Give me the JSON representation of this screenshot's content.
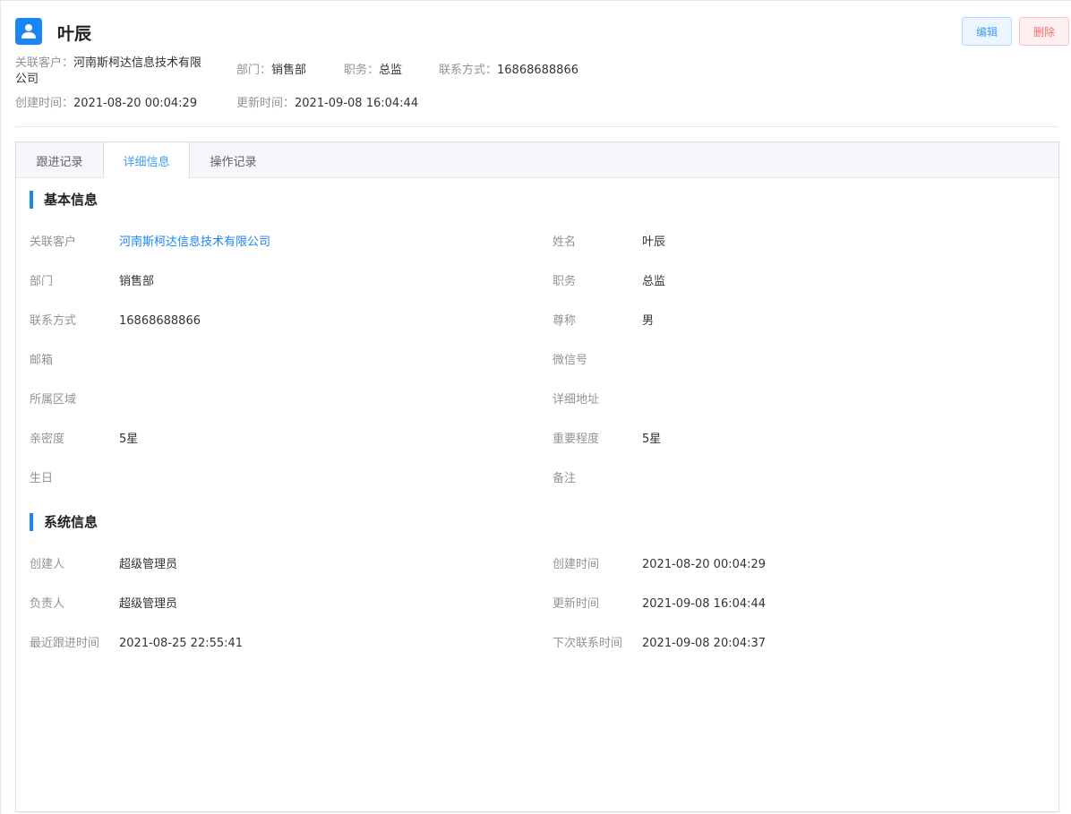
{
  "contact": {
    "name": "叶辰"
  },
  "actions": {
    "edit": "编辑",
    "delete": "删除"
  },
  "summary": {
    "customer_label": "关联客户：",
    "customer_value": "河南斯柯达信息技术有限公司",
    "dept_label": "部门：",
    "dept_value": "销售部",
    "title_label": "职务：",
    "title_value": "总监",
    "phone_label": "联系方式：",
    "phone_value": "16868688866",
    "created_label": "创建时间：",
    "created_value": "2021-08-20 00:04:29",
    "updated_label": "更新时间：",
    "updated_value": "2021-09-08 16:04:44"
  },
  "tabs": [
    "跟进记录",
    "详细信息",
    "操作记录"
  ],
  "active_tab": "详细信息",
  "basic": {
    "title": "基本信息",
    "fields": [
      {
        "label": "关联客户",
        "value": "河南斯柯达信息技术有限公司"
      },
      {
        "label": "姓名",
        "value": "叶辰"
      },
      {
        "label": "部门",
        "value": "销售部"
      },
      {
        "label": "职务",
        "value": "总监"
      },
      {
        "label": "联系方式",
        "value": "16868688866"
      },
      {
        "label": "尊称",
        "value": "男"
      },
      {
        "label": "邮箱",
        "value": ""
      },
      {
        "label": "微信号",
        "value": ""
      },
      {
        "label": "所属区域",
        "value": ""
      },
      {
        "label": "详细地址",
        "value": ""
      },
      {
        "label": "亲密度",
        "value": "5星"
      },
      {
        "label": "重要程度",
        "value": "5星"
      },
      {
        "label": "生日",
        "value": ""
      },
      {
        "label": "备注",
        "value": ""
      }
    ]
  },
  "system": {
    "title": "系统信息",
    "fields": [
      {
        "label": "创建人",
        "value": "超级管理员"
      },
      {
        "label": "创建时间",
        "value": "2021-08-20 00:04:29"
      },
      {
        "label": "负责人",
        "value": "超级管理员"
      },
      {
        "label": "更新时间",
        "value": "2021-09-08 16:04:44"
      },
      {
        "label": "最近跟进时间",
        "value": "2021-08-25 22:55:41"
      },
      {
        "label": "下次联系时间",
        "value": "2021-09-08 20:04:37"
      }
    ]
  },
  "colors": {
    "accent": "#1a86f5",
    "danger": "#f56c6c"
  }
}
